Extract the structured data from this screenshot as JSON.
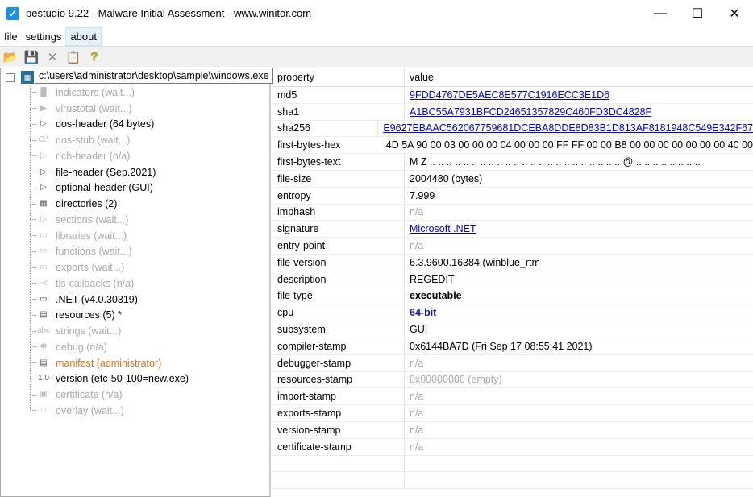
{
  "window": {
    "title": "pestudio 9.22 - Malware Initial Assessment - www.winitor.com"
  },
  "menu": [
    "file",
    "settings",
    "about"
  ],
  "toolbar": [
    "open-icon",
    "save-icon",
    "close-icon",
    "clipboard-icon",
    "help-icon"
  ],
  "tree": {
    "root_path": "c:\\users\\administrator\\desktop\\sample\\windows.exe",
    "items": [
      {
        "label": "indicators (wait...)",
        "state": "dim",
        "icon": "▐▌"
      },
      {
        "label": "virustotal (wait...)",
        "state": "dim",
        "icon": "▶"
      },
      {
        "label": "dos-header (64 bytes)",
        "state": "normal",
        "icon": "▷"
      },
      {
        "label": "dos-stub (wait...)",
        "state": "dim",
        "icon": "C:\\"
      },
      {
        "label": "rich-header (n/a)",
        "state": "dim",
        "icon": "▷"
      },
      {
        "label": "file-header (Sep.2021)",
        "state": "normal",
        "icon": "▷"
      },
      {
        "label": "optional-header (GUI)",
        "state": "normal",
        "icon": "▷"
      },
      {
        "label": "directories (2)",
        "state": "normal",
        "icon": "▦"
      },
      {
        "label": "sections (wait...)",
        "state": "dim",
        "icon": "▷"
      },
      {
        "label": "libraries (wait...)",
        "state": "dim",
        "icon": "▭"
      },
      {
        "label": "functions (wait...)",
        "state": "dim",
        "icon": "▭"
      },
      {
        "label": "exports (wait...)",
        "state": "dim",
        "icon": "▭"
      },
      {
        "label": "tls-callbacks (n/a)",
        "state": "dim",
        "icon": "─o"
      },
      {
        "label": ".NET (v4.0.30319)",
        "state": "normal",
        "icon": "▭"
      },
      {
        "label": "resources (5) *",
        "state": "normal",
        "icon": "▤"
      },
      {
        "label": "strings (wait...)",
        "state": "dim",
        "icon": "abc"
      },
      {
        "label": "debug (n/a)",
        "state": "dim",
        "icon": "✱"
      },
      {
        "label": "manifest (administrator)",
        "state": "orange",
        "icon": "▤"
      },
      {
        "label": "version (etc-50-100=new.exe)",
        "state": "normal",
        "icon": "1.0"
      },
      {
        "label": "certificate (n/a)",
        "state": "dim",
        "icon": "▣"
      },
      {
        "label": "overlay (wait...)",
        "state": "dim",
        "icon": "□"
      }
    ]
  },
  "table": {
    "headers": [
      "property",
      "value"
    ],
    "rows": [
      [
        "md5",
        "9FDD4767DE5AEC8E577C1916ECC3E1D6",
        "link"
      ],
      [
        "sha1",
        "A1BC55A7931BFCD24651357829C460FD3DC4828F",
        "link"
      ],
      [
        "sha256",
        "E9627EBAAC562067759681DCEBA8DDE8D83B1D813AF8181948C549E342F67",
        "link"
      ],
      [
        "first-bytes-hex",
        "4D 5A 90 00 03 00 00 00 04 00 00 00 FF FF 00 00 B8 00 00 00 00 00 00 00 40 00",
        ""
      ],
      [
        "first-bytes-text",
        "M Z .. .. .. .. .. .. .. .. .. .. .. .. .. .. .. .. .. .. .. .. .. .. .. @ .. .. .. .. .. .. .. ..",
        ""
      ],
      [
        "file-size",
        "2004480 (bytes)",
        ""
      ],
      [
        "entropy",
        "7.999",
        ""
      ],
      [
        "imphash",
        "n/a",
        "dim"
      ],
      [
        "signature",
        "Microsoft .NET",
        "link"
      ],
      [
        "entry-point",
        "n/a",
        "dim"
      ],
      [
        "file-version",
        "6.3.9600.16384 (winblue_rtm",
        ""
      ],
      [
        "description",
        "REGEDIT",
        ""
      ],
      [
        "file-type",
        "executable",
        "bold"
      ],
      [
        "cpu",
        "64-bit",
        "blue"
      ],
      [
        "subsystem",
        "GUI",
        ""
      ],
      [
        "compiler-stamp",
        "0x6144BA7D (Fri Sep 17 08:55:41 2021)",
        ""
      ],
      [
        "debugger-stamp",
        "n/a",
        "dim"
      ],
      [
        "resources-stamp",
        "0x00000000 (empty)",
        "dim"
      ],
      [
        "import-stamp",
        "n/a",
        "dim"
      ],
      [
        "exports-stamp",
        "n/a",
        "dim"
      ],
      [
        "version-stamp",
        "n/a",
        "dim"
      ],
      [
        "certificate-stamp",
        "n/a",
        "dim"
      ],
      [
        "",
        ""
      ],
      [
        "",
        ""
      ]
    ]
  }
}
